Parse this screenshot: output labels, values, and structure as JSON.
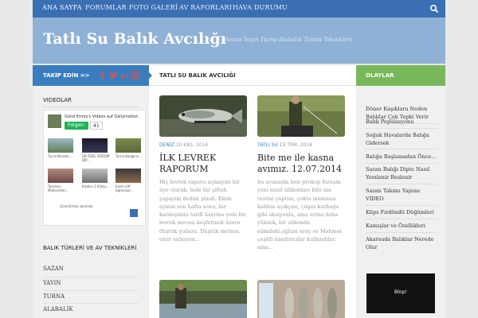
{
  "nav": {
    "items": [
      "ANA SAYFA",
      "FORUMLAR",
      "FOTO GALERİ",
      "AV RAPORLARI",
      "HAVA DURUMU"
    ]
  },
  "header": {
    "title": "Tatlı Su Balık Avcılığı",
    "tagline": "Sazan Yayın Turna Alabalık Tutma Teknikleri"
  },
  "follow_bar": {
    "label": "TAKİP EDİN =>"
  },
  "main_bar": {
    "label": "TATLI SU BALIK AVCILIĞI"
  },
  "events_bar": {
    "label": "OLAYLAR"
  },
  "left": {
    "videos_heading": "VIDEOLAR",
    "dailymotion": {
      "title": "Gürol Ermiş's Videos auf Dailymotion",
      "follow_label": "Folgen",
      "follow_count": "41",
      "videos": [
        "Turna Nerede...",
        "UB ÖZEL DÜĞÜM DİP...",
        "Turna Balığının...",
        "Tumanın Midesinden...",
        "Kızılkın 1 Kilolu...",
        "Kızım LRF öğreniyor..."
      ],
      "footer": "Gürol Ermiş üzerinde"
    },
    "categories_heading": "BALIK TÜRLERİ VE AV TEKNİKLERİ",
    "categories": [
      "SAZAN",
      "YAYIN",
      "TURNA",
      "ALABALIK"
    ]
  },
  "posts": [
    {
      "category": "DENİZ",
      "date": "10 KAS, 2014",
      "title": "İLK LEVREK RAPORUM",
      "excerpt": "Hiç levrek raporu açmayan bir üye olarak, hele bir şiftah yapayım dedim şimdi. Ekim ayının son hafta sonu, bir kardeşimin tarifi üzerine yeni bir levrek merası keşfetmek üzere düştük yollara. Düştük derken, emir subayım..."
    },
    {
      "category": "TATLI SU",
      "date": "19 TEM, 2014",
      "title": "Bite me ile kasna avımız. 12.07.2014",
      "excerpt": "bu avımızda ben prokop furesin yeni nesil silikonları bite me testini yaptım, çokta memnun kaldım açıkçası, çılgın kurbağa gibi aksiyonlu, ama erimi daha yüksek, bir silkonda elimdeki,oğlum eray ve Mehmet çeşitli kandırıcılar kullandılar. ama..."
    }
  ],
  "events": [
    "Döner Kaşıklara Neden Balıklar Çok Tepki Verir",
    "Balık Popülasyonu",
    "Soğuk Havalarda Balığa Gidersek",
    "Balığa Başlamadan Önce...",
    "Sazan Balığı Dipte Nasıl Yemlenir Beslenir",
    "Sazan Takımı Yapımı VIDEO",
    "Klips Fırdöndü Düğümleri",
    "Kamışlar ve Özellikleri",
    "Akarsuda Balıklar Nerede Olur"
  ],
  "ad": {
    "label": "Blop!"
  },
  "colors": {
    "nav": "#3b6fb4",
    "header": "#8fb1d6",
    "follow": "#3a7dbf",
    "events": "#79b85a",
    "facebook": "#d9534f"
  },
  "icons": [
    "search-icon",
    "facebook-icon",
    "twitter-icon",
    "googleplus-icon",
    "instagram-icon",
    "dailymotion-logo-icon"
  ]
}
